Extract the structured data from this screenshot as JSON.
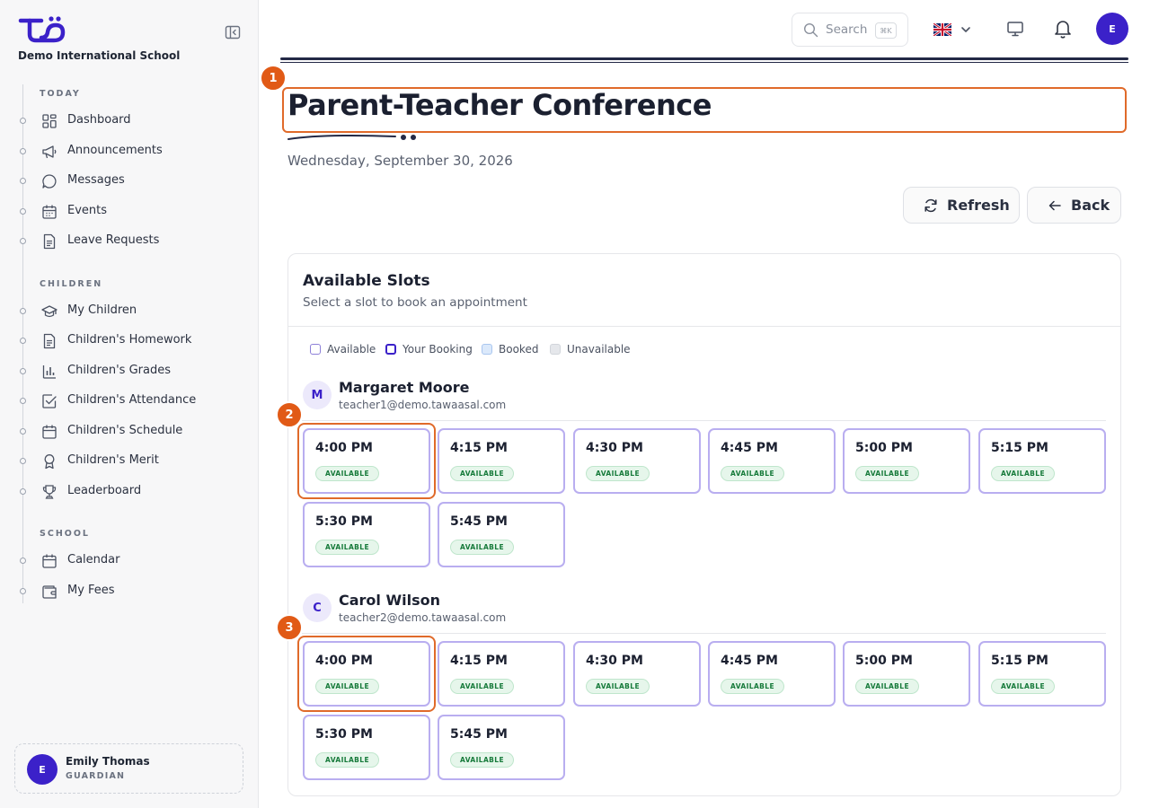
{
  "sidebar": {
    "school_name": "Demo International School",
    "sections": [
      {
        "title": "TODAY",
        "items": [
          {
            "label": "Dashboard",
            "icon": "dashboard-icon"
          },
          {
            "label": "Announcements",
            "icon": "megaphone-icon"
          },
          {
            "label": "Messages",
            "icon": "message-icon"
          },
          {
            "label": "Events",
            "icon": "calendar-icon"
          },
          {
            "label": "Leave Requests",
            "icon": "document-icon"
          }
        ]
      },
      {
        "title": "CHILDREN",
        "items": [
          {
            "label": "My Children",
            "icon": "graduation-cap-icon"
          },
          {
            "label": "Children's Homework",
            "icon": "document-icon"
          },
          {
            "label": "Children's Grades",
            "icon": "bar-chart-icon"
          },
          {
            "label": "Children's Attendance",
            "icon": "checkbox-icon"
          },
          {
            "label": "Children's Schedule",
            "icon": "calendar-icon"
          },
          {
            "label": "Children's Merit",
            "icon": "award-icon"
          },
          {
            "label": "Leaderboard",
            "icon": "trophy-icon"
          }
        ]
      },
      {
        "title": "SCHOOL",
        "items": [
          {
            "label": "Calendar",
            "icon": "calendar-icon"
          },
          {
            "label": "My Fees",
            "icon": "wallet-icon"
          }
        ]
      }
    ],
    "user": {
      "initial": "E",
      "name": "Emily Thomas",
      "role": "GUARDIAN"
    }
  },
  "topbar": {
    "search_placeholder": "Search",
    "search_shortcut": "⌘K",
    "avatar_initial": "E"
  },
  "page": {
    "title": "Parent-Teacher Conference",
    "date": "Wednesday, September 30, 2026",
    "refresh_label": "Refresh",
    "back_label": "Back"
  },
  "annotations": [
    "1",
    "2",
    "3"
  ],
  "slots_card": {
    "title": "Available Slots",
    "subtitle": "Select a slot to book an appointment",
    "legend": [
      {
        "label": "Available",
        "fill": "#ffffff",
        "border": "#8d80d8"
      },
      {
        "label": "Your Booking",
        "fill": "#ffffff",
        "border": "#3b21c9"
      },
      {
        "label": "Booked",
        "fill": "#dbe9fb",
        "border": "#a9c6ef"
      },
      {
        "label": "Unavailable",
        "fill": "#e5e7eb",
        "border": "#d1d5db"
      }
    ],
    "teachers": [
      {
        "initial": "M",
        "name": "Margaret Moore",
        "email": "teacher1@demo.tawaasal.com",
        "slots": [
          {
            "time": "4:00 PM",
            "status": "AVAILABLE"
          },
          {
            "time": "4:15 PM",
            "status": "AVAILABLE"
          },
          {
            "time": "4:30 PM",
            "status": "AVAILABLE"
          },
          {
            "time": "4:45 PM",
            "status": "AVAILABLE"
          },
          {
            "time": "5:00 PM",
            "status": "AVAILABLE"
          },
          {
            "time": "5:15 PM",
            "status": "AVAILABLE"
          },
          {
            "time": "5:30 PM",
            "status": "AVAILABLE"
          },
          {
            "time": "5:45 PM",
            "status": "AVAILABLE"
          }
        ]
      },
      {
        "initial": "C",
        "name": "Carol Wilson",
        "email": "teacher2@demo.tawaasal.com",
        "slots": [
          {
            "time": "4:00 PM",
            "status": "AVAILABLE"
          },
          {
            "time": "4:15 PM",
            "status": "AVAILABLE"
          },
          {
            "time": "4:30 PM",
            "status": "AVAILABLE"
          },
          {
            "time": "4:45 PM",
            "status": "AVAILABLE"
          },
          {
            "time": "5:00 PM",
            "status": "AVAILABLE"
          },
          {
            "time": "5:15 PM",
            "status": "AVAILABLE"
          },
          {
            "time": "5:30 PM",
            "status": "AVAILABLE"
          },
          {
            "time": "5:45 PM",
            "status": "AVAILABLE"
          }
        ]
      }
    ]
  },
  "colors": {
    "accent": "#3b21c9",
    "highlight": "#e15a16",
    "slot_border": "#b9aef0",
    "available_badge": "#e6f6eb"
  }
}
